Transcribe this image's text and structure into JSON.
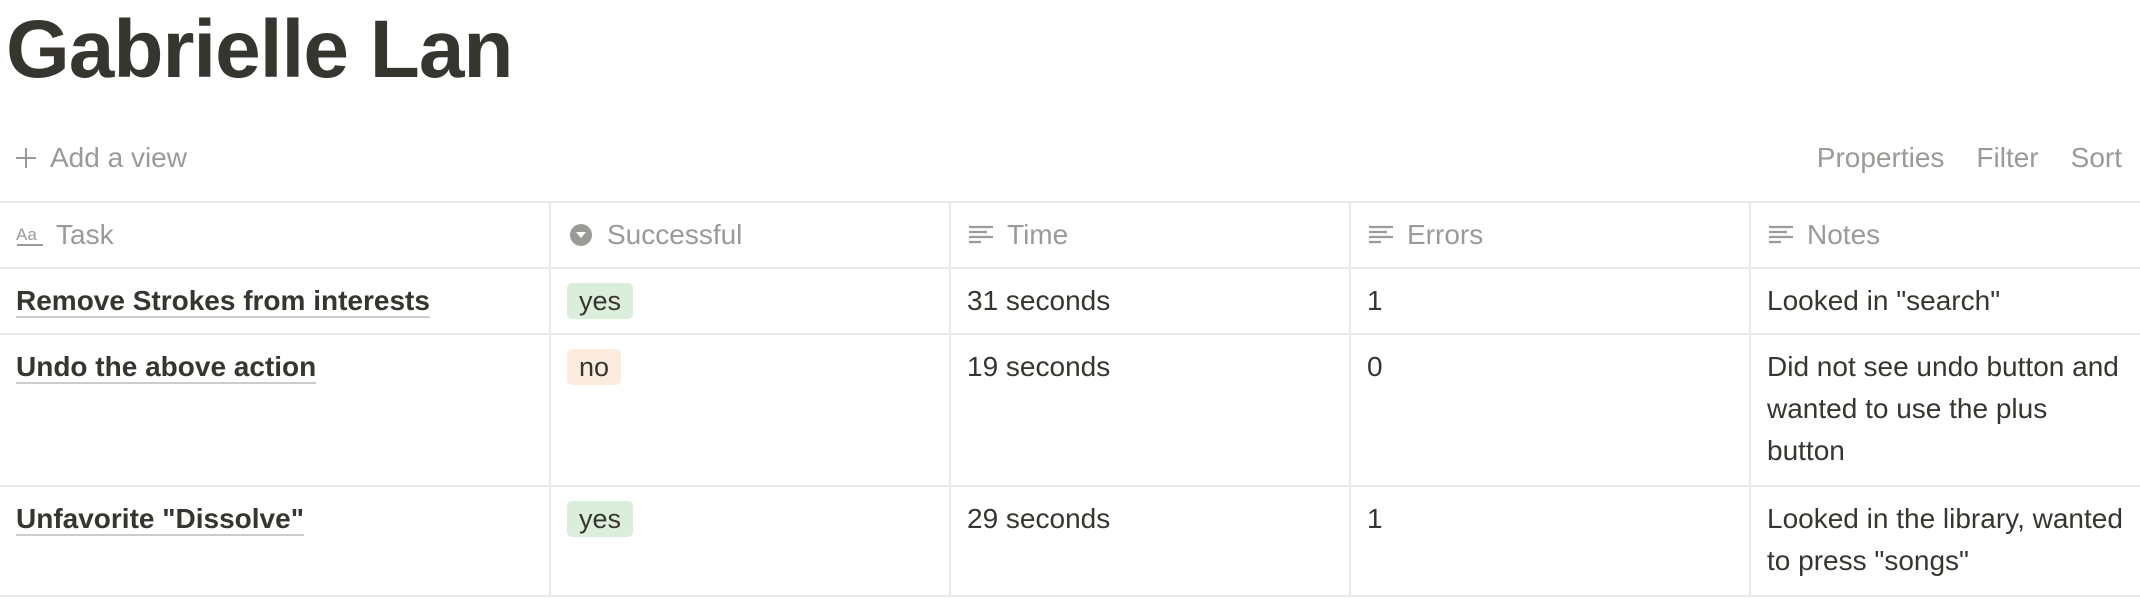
{
  "page": {
    "title": "Gabrielle Lan"
  },
  "viewbar": {
    "add_view_label": "Add a view",
    "actions": [
      "Properties",
      "Filter",
      "Sort"
    ]
  },
  "table": {
    "columns": [
      {
        "label": "Task",
        "icon": "title-aa-icon"
      },
      {
        "label": "Successful",
        "icon": "select-chevron-icon"
      },
      {
        "label": "Time",
        "icon": "text-lines-icon"
      },
      {
        "label": "Errors",
        "icon": "text-lines-icon"
      },
      {
        "label": "Notes",
        "icon": "text-lines-icon"
      }
    ],
    "rows": [
      {
        "task": "Remove Strokes from interests",
        "successful": "yes",
        "time": "31 seconds",
        "errors": "1",
        "notes": "Looked in \"search\""
      },
      {
        "task": "Undo the above action",
        "successful": "no",
        "time": "19 seconds",
        "errors": "0",
        "notes": "Did not see undo button and wanted to use the plus button"
      },
      {
        "task": "Unfavorite \"Dissolve\"",
        "successful": "yes",
        "time": "29 seconds",
        "errors": "1",
        "notes": "Looked in the library, wanted to press \"songs\""
      }
    ]
  },
  "colors": {
    "tag_yes_bg": "#dbeddb",
    "tag_no_bg": "#fbecdd",
    "text": "#37352f",
    "muted": "#9b9a97",
    "border": "#e9e9e7"
  }
}
